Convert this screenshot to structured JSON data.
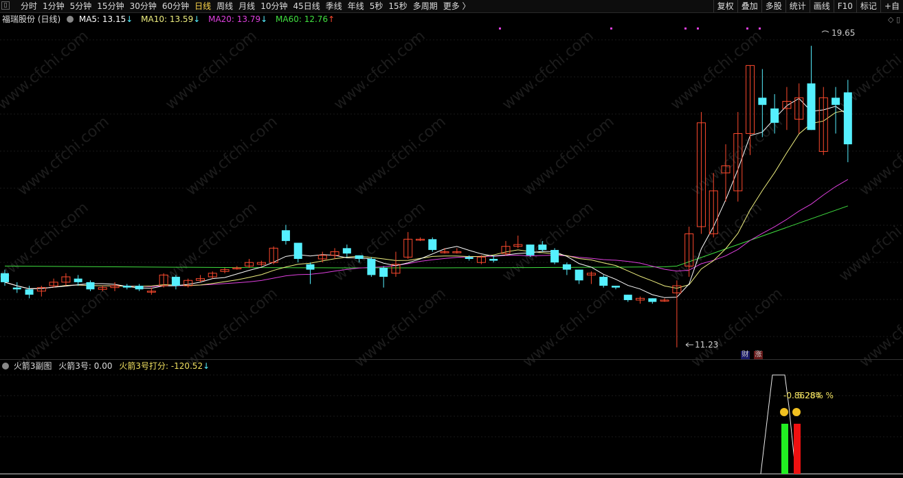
{
  "toolbar": {
    "periods": [
      "分时",
      "1分钟",
      "5分钟",
      "15分钟",
      "30分钟",
      "60分钟",
      "日线",
      "周线",
      "月线",
      "10分钟",
      "45日线",
      "季线",
      "年线",
      "5秒",
      "15秒",
      "多周期",
      "更多 〉"
    ],
    "active_period": "日线",
    "tools": [
      "复权",
      "叠加",
      "多股",
      "统计",
      "画线",
      "F10",
      "标记",
      "+自"
    ]
  },
  "stock": {
    "name": "福瑞股份 (日线)",
    "ma5": "MA5: 13.15",
    "ma10": "MA10: 13.59",
    "ma20": "MA20: 13.79",
    "ma60": "MA60: 12.76",
    "arrow_down": "↓",
    "arrow_up": "↑",
    "high_label": "19.65",
    "low_label": "11.23",
    "badge_cai": "财",
    "badge_zhang": "涨"
  },
  "sub_indicator": {
    "name": "火箭3副图",
    "v1": "火箭3号: 0.00",
    "v2": "火箭3号打分: -120.52",
    "arrow": "↓",
    "overlap_text": "-0.8628% %",
    "overlap_text2": "5.284"
  },
  "colors": {
    "up": "#ff4a2e",
    "down": "#55f0ff",
    "ma5": "#ffffff",
    "ma10": "#f0f080",
    "ma20": "#e040e0",
    "ma60": "#40e040",
    "active": "#ffd84a"
  },
  "watermark": "www.cfchi.com",
  "chart_data": {
    "type": "candlestick",
    "high": 19.65,
    "low": 11.23,
    "candles": [
      [
        13.3,
        13.05,
        13.4,
        12.95
      ],
      [
        12.9,
        12.85,
        13.05,
        12.75
      ],
      [
        12.85,
        12.7,
        12.95,
        12.6
      ],
      [
        12.8,
        12.9,
        12.95,
        12.65
      ],
      [
        12.95,
        13.05,
        13.15,
        12.9
      ],
      [
        13.05,
        13.2,
        13.3,
        12.95
      ],
      [
        13.15,
        13.05,
        13.25,
        12.95
      ],
      [
        13.05,
        12.85,
        13.1,
        12.8
      ],
      [
        12.85,
        12.9,
        12.95,
        12.8
      ],
      [
        12.9,
        12.95,
        13.05,
        12.8
      ],
      [
        12.95,
        12.9,
        13.0,
        12.85
      ],
      [
        12.95,
        12.85,
        13.0,
        12.8
      ],
      [
        12.8,
        12.8,
        12.9,
        12.7
      ],
      [
        12.95,
        13.25,
        13.3,
        12.9
      ],
      [
        13.2,
        12.95,
        13.25,
        12.85
      ],
      [
        12.95,
        13.1,
        13.15,
        12.9
      ],
      [
        13.1,
        13.15,
        13.25,
        13.05
      ],
      [
        13.2,
        13.3,
        13.35,
        13.15
      ],
      [
        13.35,
        13.4,
        13.45,
        13.3
      ],
      [
        13.45,
        13.45,
        13.5,
        13.4
      ],
      [
        13.5,
        13.6,
        13.7,
        13.45
      ],
      [
        13.55,
        13.6,
        13.65,
        13.5
      ],
      [
        13.6,
        14.0,
        14.05,
        13.55
      ],
      [
        14.5,
        14.2,
        14.65,
        14.1
      ],
      [
        14.15,
        13.7,
        14.15,
        13.6
      ],
      [
        13.55,
        13.4,
        13.6,
        13.0
      ],
      [
        13.7,
        13.8,
        13.9,
        13.6
      ],
      [
        13.8,
        13.9,
        14.0,
        13.7
      ],
      [
        14.0,
        13.85,
        14.1,
        13.75
      ],
      [
        13.8,
        13.7,
        13.8,
        13.6
      ],
      [
        13.7,
        13.25,
        13.75,
        13.2
      ],
      [
        13.45,
        13.2,
        13.5,
        12.9
      ],
      [
        13.3,
        13.55,
        13.9,
        13.2
      ],
      [
        13.75,
        14.25,
        14.45,
        13.7
      ],
      [
        14.25,
        14.25,
        14.3,
        14.2
      ],
      [
        14.25,
        13.95,
        14.3,
        13.9
      ],
      [
        13.9,
        13.9,
        14.0,
        13.85
      ],
      [
        13.9,
        13.9,
        14.0,
        13.85
      ],
      [
        13.75,
        13.7,
        13.8,
        13.65
      ],
      [
        13.6,
        13.75,
        13.8,
        13.55
      ],
      [
        13.7,
        13.65,
        13.8,
        13.6
      ],
      [
        13.85,
        14.05,
        14.2,
        13.8
      ],
      [
        14.05,
        14.1,
        14.35,
        14.0
      ],
      [
        14.1,
        13.8,
        14.1,
        13.75
      ],
      [
        14.1,
        13.95,
        14.2,
        13.9
      ],
      [
        13.95,
        13.6,
        14.0,
        13.55
      ],
      [
        13.55,
        13.4,
        13.6,
        13.25
      ],
      [
        13.4,
        13.1,
        13.4,
        13.0
      ],
      [
        13.25,
        13.3,
        13.35,
        13.0
      ],
      [
        13.2,
        12.95,
        13.25,
        12.9
      ],
      [
        12.95,
        12.9,
        12.95,
        12.85
      ],
      [
        12.7,
        12.55,
        12.7,
        12.5
      ],
      [
        12.55,
        12.6,
        12.65,
        12.45
      ],
      [
        12.6,
        12.5,
        12.6,
        12.45
      ],
      [
        12.55,
        12.55,
        12.6,
        12.5
      ],
      [
        12.75,
        12.95,
        13.1,
        11.23
      ],
      [
        13.5,
        14.4,
        14.6,
        13.2
      ],
      [
        14.6,
        17.5,
        17.8,
        14.4
      ],
      [
        14.4,
        15.6,
        16.1,
        14.3
      ],
      [
        16.1,
        16.3,
        16.9,
        15.3
      ],
      [
        15.6,
        17.2,
        17.8,
        15.3
      ],
      [
        17.2,
        19.1,
        19.1,
        16.6
      ],
      [
        18.2,
        18.0,
        19.0,
        17.1
      ],
      [
        17.9,
        17.5,
        18.3,
        17.2
      ],
      [
        17.9,
        18.1,
        18.5,
        17.3
      ],
      [
        17.6,
        18.2,
        18.6,
        17.2
      ],
      [
        18.6,
        17.3,
        19.65,
        17.3
      ],
      [
        16.7,
        18.2,
        18.5,
        16.6
      ],
      [
        18.2,
        18.0,
        18.5,
        17.2
      ],
      [
        18.35,
        16.9,
        18.7,
        16.4
      ]
    ]
  }
}
